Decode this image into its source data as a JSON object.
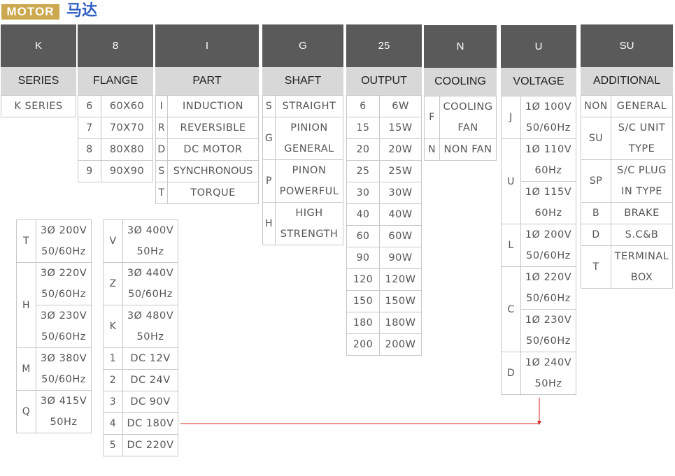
{
  "title": {
    "badge": "MOTOR",
    "chinese": "马达"
  },
  "columns": {
    "series": {
      "code": "K",
      "label": "SERIES",
      "rows": [
        [
          "",
          "K SERIES"
        ]
      ]
    },
    "flange": {
      "code": "8",
      "label": "FLANGE",
      "rows": [
        [
          "6",
          "60X60"
        ],
        [
          "7",
          "70X70"
        ],
        [
          "8",
          "80X80"
        ],
        [
          "9",
          "90X90"
        ]
      ]
    },
    "part": {
      "code": "I",
      "label": "PART",
      "rows": [
        [
          "I",
          "INDUCTION"
        ],
        [
          "R",
          "REVERSIBLE"
        ],
        [
          "D",
          "DC MOTOR"
        ],
        [
          "S",
          "SYNCHRONOUS"
        ],
        [
          "T",
          "TORQUE"
        ]
      ]
    },
    "shaft": {
      "code": "G",
      "label": "SHAFT",
      "rows": [
        [
          "S",
          "STRAIGHT"
        ],
        [
          "G",
          "PINION",
          "GENERAL"
        ],
        [
          "P",
          "PINON",
          "POWERFUL"
        ],
        [
          "H",
          "HIGH",
          "STRENGTH"
        ]
      ]
    },
    "output": {
      "code": "25",
      "label": "OUTPUT",
      "rows": [
        [
          "6",
          "6W"
        ],
        [
          "15",
          "15W"
        ],
        [
          "20",
          "20W"
        ],
        [
          "25",
          "25W"
        ],
        [
          "30",
          "30W"
        ],
        [
          "40",
          "40W"
        ],
        [
          "60",
          "60W"
        ],
        [
          "90",
          "90W"
        ],
        [
          "120",
          "120W"
        ],
        [
          "150",
          "150W"
        ],
        [
          "180",
          "180W"
        ],
        [
          "200",
          "200W"
        ]
      ]
    },
    "cooling": {
      "code": "N",
      "label": "COOLING",
      "rows": [
        [
          "F",
          "COOLING",
          "FAN"
        ],
        [
          "N",
          "NON FAN"
        ]
      ]
    },
    "voltage": {
      "code": "U",
      "label": "VOLTAGE",
      "rows": [
        [
          "J",
          "1Ø 100V",
          "50/60Hz"
        ],
        [
          "U",
          "1Ø 110V",
          "60Hz"
        ],
        [
          "",
          "1Ø 115V",
          "60Hz"
        ],
        [
          "L",
          "1Ø 200V",
          "50/60Hz"
        ],
        [
          "C",
          "1Ø 220V",
          "50/60Hz"
        ],
        [
          "",
          "1Ø 230V",
          "50/60Hz"
        ],
        [
          "D",
          "1Ø 240V",
          "50Hz"
        ]
      ]
    },
    "additional": {
      "code": "SU",
      "label": "ADDITIONAL",
      "rows": [
        [
          "NON",
          "GENERAL"
        ],
        [
          "SU",
          "S/C UNIT",
          "TYPE"
        ],
        [
          "SP",
          "S/C PLUG",
          "IN TYPE"
        ],
        [
          "B",
          "BRAKE"
        ],
        [
          "D",
          "S.C&B"
        ],
        [
          "T",
          "TERMINAL",
          "BOX"
        ]
      ]
    }
  },
  "voltage_ext1": {
    "rows": [
      [
        "T",
        "3Ø 200V",
        "50/60Hz"
      ],
      [
        "H",
        "3Ø 220V",
        "50/60Hz"
      ],
      [
        "",
        "3Ø 230V",
        "50/60Hz"
      ],
      [
        "M",
        "3Ø 380V",
        "50/60Hz"
      ],
      [
        "Q",
        "3Ø 415V",
        "50Hz"
      ]
    ]
  },
  "voltage_ext2": {
    "rows": [
      [
        "V",
        "3Ø 400V",
        "50Hz"
      ],
      [
        "Z",
        "3Ø 440V",
        "50/60Hz"
      ],
      [
        "K",
        "3Ø 480V",
        "50Hz"
      ],
      [
        "1",
        "DC 12V"
      ],
      [
        "2",
        "DC 24V"
      ],
      [
        "3",
        "DC 90V"
      ],
      [
        "4",
        "DC 180V"
      ],
      [
        "5",
        "DC 220V"
      ]
    ]
  },
  "colors": {
    "badge": "#cca84e",
    "title": "#2f5fc4",
    "header": "#5a5a5a",
    "subheader": "#d8d8d8",
    "connector": "#d12a2a"
  }
}
